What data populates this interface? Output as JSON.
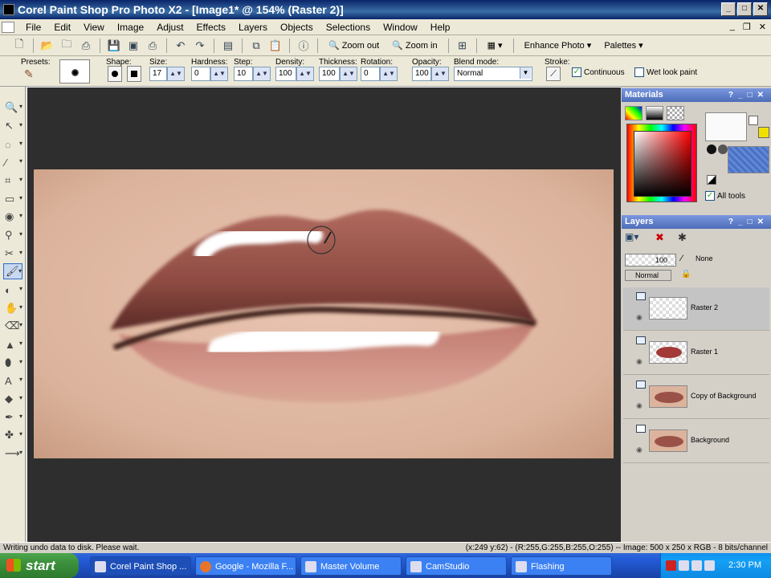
{
  "window": {
    "title": "Corel Paint Shop Pro Photo X2 - [Image1* @ 154% (Raster 2)]"
  },
  "menu": [
    "File",
    "Edit",
    "View",
    "Image",
    "Adjust",
    "Effects",
    "Layers",
    "Objects",
    "Selections",
    "Window",
    "Help"
  ],
  "toolbar": {
    "zoom_out": "Zoom out",
    "zoom_in": "Zoom in",
    "enhance": "Enhance Photo",
    "palettes": "Palettes"
  },
  "options": {
    "presets_label": "Presets:",
    "shape_label": "Shape:",
    "size_label": "Size:",
    "size": "17",
    "hardness_label": "Hardness:",
    "hardness": "0",
    "step_label": "Step:",
    "step": "10",
    "density_label": "Density:",
    "density": "100",
    "thickness_label": "Thickness:",
    "thickness": "100",
    "rotation_label": "Rotation:",
    "rotation": "0",
    "opacity_label": "Opacity:",
    "opacity": "100",
    "blend_label": "Blend mode:",
    "blend": "Normal",
    "stroke_label": "Stroke:",
    "continuous": "Continuous",
    "wet_look": "Wet look paint"
  },
  "materials": {
    "title": "Materials",
    "all_tools": "All tools"
  },
  "layers": {
    "title": "Layers",
    "opacity": "100",
    "blend": "Normal",
    "none": "None",
    "items": [
      {
        "name": "Raster 2",
        "selected": true
      },
      {
        "name": "Raster 1",
        "selected": false
      },
      {
        "name": "Copy of Background",
        "selected": false
      },
      {
        "name": "Background",
        "selected": false
      }
    ]
  },
  "status": {
    "left": "Writing undo data to disk.  Please wait.",
    "right": "(x:249 y:62) - (R:255,G:255,B:255,O:255) -- Image:  500 x 250 x RGB - 8 bits/channel"
  },
  "taskbar": {
    "start": "start",
    "tasks": [
      "Corel Paint Shop ...",
      "Google - Mozilla F...",
      "Master Volume",
      "CamStudio",
      "Flashing"
    ],
    "clock": "2:30 PM"
  }
}
